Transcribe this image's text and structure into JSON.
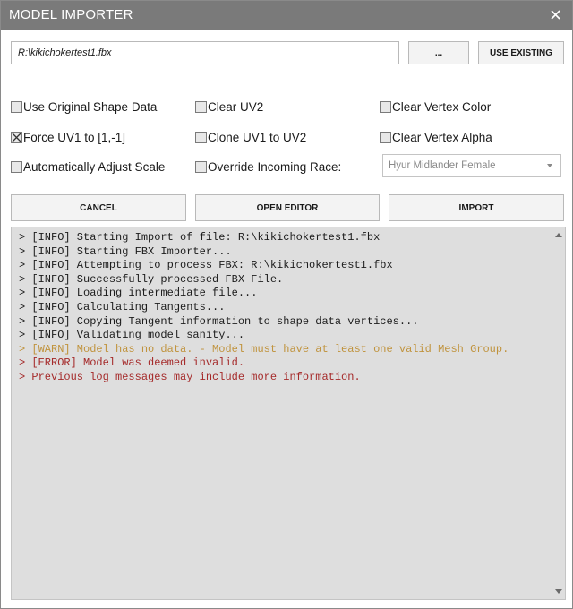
{
  "window": {
    "title": "MODEL IMPORTER",
    "close_icon": "close-icon"
  },
  "file": {
    "path": "R:\\kikichokertest1.fbx",
    "browse_label": "...",
    "use_existing_label": "USE EXISTING"
  },
  "options": {
    "use_original_shape_data": {
      "label": "Use Original Shape Data",
      "checked": false
    },
    "clear_uv2": {
      "label": "Clear UV2",
      "checked": false
    },
    "clear_vertex_color": {
      "label": "Clear Vertex Color",
      "checked": false
    },
    "force_uv1": {
      "label": "Force UV1 to [1,-1]",
      "checked": true
    },
    "clone_uv1_to_uv2": {
      "label": "Clone UV1 to UV2",
      "checked": false
    },
    "clear_vertex_alpha": {
      "label": "Clear Vertex Alpha",
      "checked": false
    },
    "auto_adjust_scale": {
      "label": "Automatically Adjust Scale",
      "checked": false
    },
    "override_race": {
      "label": "Override Incoming Race:",
      "checked": false
    }
  },
  "race_select": {
    "value": "Hyur Midlander Female",
    "enabled": false
  },
  "actions": {
    "cancel_label": "CANCEL",
    "open_editor_label": "OPEN EDITOR",
    "import_label": "IMPORT"
  },
  "log": {
    "lines": [
      {
        "level": "info",
        "text": "> [INFO] Starting Import of file: R:\\kikichokertest1.fbx"
      },
      {
        "level": "info",
        "text": "> [INFO] Starting FBX Importer..."
      },
      {
        "level": "info",
        "text": "> [INFO] Attempting to process FBX: R:\\kikichokertest1.fbx"
      },
      {
        "level": "info",
        "text": "> [INFO] Successfully processed FBX File."
      },
      {
        "level": "info",
        "text": "> [INFO] Loading intermediate file..."
      },
      {
        "level": "info",
        "text": "> [INFO] Calculating Tangents..."
      },
      {
        "level": "info",
        "text": "> [INFO] Copying Tangent information to shape data vertices..."
      },
      {
        "level": "info",
        "text": "> [INFO] Validating model sanity..."
      },
      {
        "level": "warn",
        "text": "> [WARN] Model has no data. - Model must have at least one valid Mesh Group."
      },
      {
        "level": "error",
        "text": "> [ERROR] Model was deemed invalid."
      },
      {
        "level": "error",
        "text": "> Previous log messages may include more information."
      }
    ]
  },
  "colors": {
    "titlebar": "#7a7a7a",
    "log_background": "#dedede",
    "warn": "#c0933d",
    "error": "#a52a2a"
  }
}
